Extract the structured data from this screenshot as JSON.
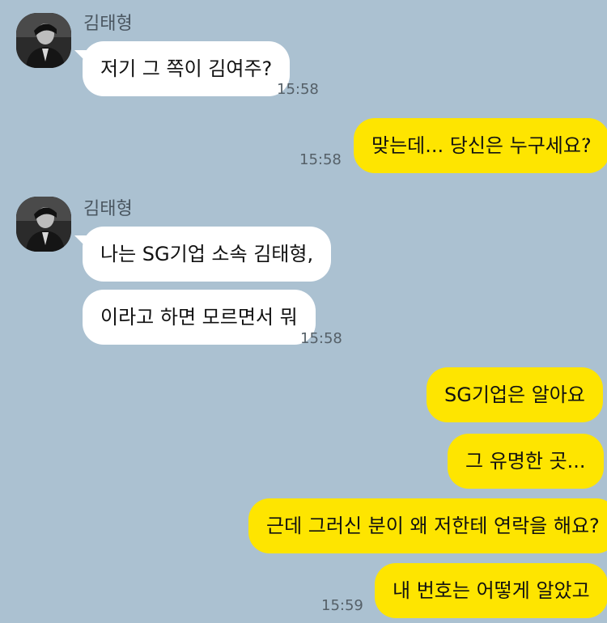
{
  "colors": {
    "background": "#abc1d1",
    "incoming_bubble": "#ffffff",
    "outgoing_bubble": "#fee500"
  },
  "groups": [
    {
      "sender": "김태형",
      "avatar": "profile-photo-icon",
      "messages": [
        "저기 그 쪽이 김여주?"
      ],
      "time": "15:58"
    },
    {
      "messages": [
        "맞는데... 당신은 누구세요?"
      ],
      "time": "15:58"
    },
    {
      "sender": "김태형",
      "avatar": "profile-photo-icon",
      "messages": [
        "나는 SG기업 소속 김태형,",
        "이라고 하면 모르면서 뭐"
      ],
      "time": "15:58"
    },
    {
      "messages": [
        "SG기업은 알아요",
        "그 유명한 곳...",
        "근데 그러신 분이 왜 저한테 연락을 해요?",
        "내 번호는 어떻게 알았고"
      ],
      "time": "15:59"
    }
  ]
}
